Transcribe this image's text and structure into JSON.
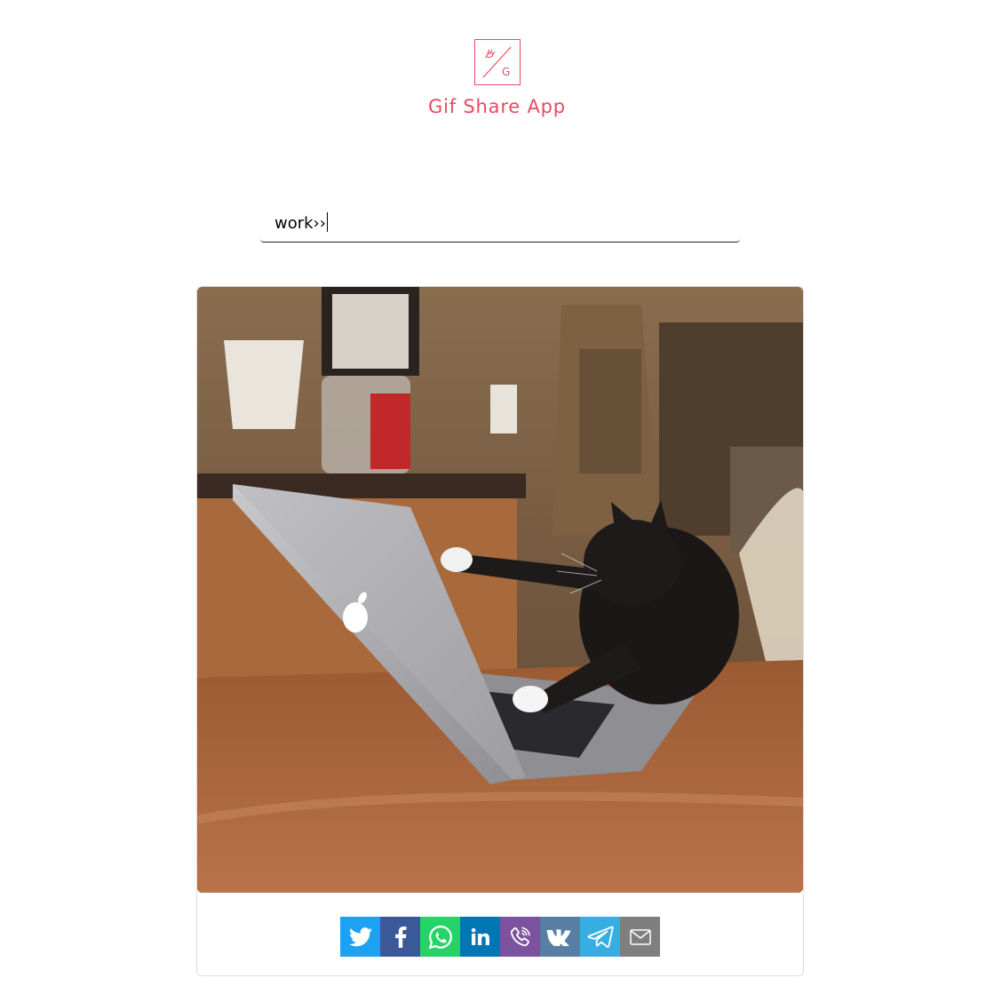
{
  "app": {
    "title": "Gif Share App",
    "logo_letter": "G",
    "accent_color": "#e84a5f"
  },
  "search": {
    "value": "work››",
    "placeholder": ""
  },
  "gif": {
    "description_icon": "cat-typing-on-laptop-gif"
  },
  "share": {
    "buttons": [
      {
        "name": "twitter",
        "icon": "twitter-icon",
        "color": "#1da1f2"
      },
      {
        "name": "facebook",
        "icon": "facebook-icon",
        "color": "#3b5998"
      },
      {
        "name": "whatsapp",
        "icon": "whatsapp-icon",
        "color": "#25d366"
      },
      {
        "name": "linkedin",
        "icon": "linkedin-icon",
        "color": "#0077b5"
      },
      {
        "name": "viber",
        "icon": "viber-icon",
        "color": "#7c529e"
      },
      {
        "name": "vk",
        "icon": "vk-icon",
        "color": "#587ea3"
      },
      {
        "name": "telegram",
        "icon": "telegram-icon",
        "color": "#37aee2"
      },
      {
        "name": "email",
        "icon": "email-icon",
        "color": "#7f7f7f"
      }
    ]
  }
}
